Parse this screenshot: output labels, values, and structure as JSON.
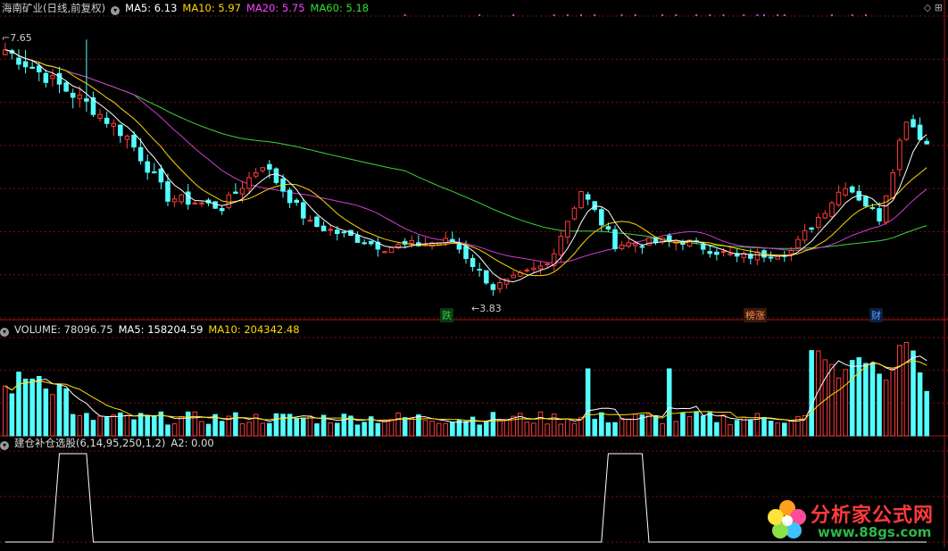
{
  "price_panel": {
    "title": "海南矿业(日线,前复权)",
    "ma": [
      {
        "label": "MA5: 6.13",
        "color": "#ffffff"
      },
      {
        "label": "MA10: 5.97",
        "color": "#ffd800"
      },
      {
        "label": "MA20: 5.75",
        "color": "#ff44ff"
      },
      {
        "label": "MA60: 5.18",
        "color": "#33dd33"
      }
    ],
    "high_label": "7.65",
    "low_label": "3.83",
    "event_tags": [
      {
        "text": "跌",
        "color": "#2ecc40"
      },
      {
        "text": "榜涨",
        "color": "#ff8c55"
      },
      {
        "text": "财",
        "color": "#5aa0ff"
      }
    ]
  },
  "volume_panel": {
    "title": "VOLUME: 78096.75",
    "ma5": "MA5: 158204.59",
    "ma10": "MA10: 204342.48"
  },
  "indicator_panel": {
    "title": "建仓补仓选股(6,14,95,250,1,2)",
    "a2": "A2: 0.00"
  },
  "watermark": {
    "cn": "分析家公式网",
    "url": "www.88gs.com"
  },
  "colors": {
    "up": "#ff3c3c",
    "down": "#54ffff",
    "ma5": "#ffffff",
    "ma10": "#ffd800",
    "ma20": "#d43cd4",
    "ma60": "#3ed23e",
    "grid": "#7a1010"
  },
  "chart_data": [
    {
      "type": "candlestick",
      "title": "海南矿业(日线,前复权)",
      "bars": 137,
      "ylim": [
        3.5,
        8.0
      ],
      "annotations": [
        {
          "label": "7.65",
          "kind": "high"
        },
        {
          "label": "3.83",
          "kind": "low"
        }
      ],
      "key_points": [
        {
          "bar": 0,
          "close": 7.5
        },
        {
          "bar": 12,
          "close": 6.7
        },
        {
          "bar": 18,
          "close": 6.2
        },
        {
          "bar": 24,
          "close": 5.3
        },
        {
          "bar": 32,
          "close": 5.15
        },
        {
          "bar": 38,
          "close": 5.8
        },
        {
          "bar": 45,
          "close": 4.9
        },
        {
          "bar": 56,
          "close": 4.55
        },
        {
          "bar": 66,
          "close": 4.65
        },
        {
          "bar": 72,
          "close": 3.95
        },
        {
          "bar": 80,
          "close": 4.3
        },
        {
          "bar": 85,
          "close": 5.4
        },
        {
          "bar": 90,
          "close": 4.6
        },
        {
          "bar": 100,
          "close": 4.65
        },
        {
          "bar": 108,
          "close": 4.4
        },
        {
          "bar": 116,
          "close": 4.5
        },
        {
          "bar": 124,
          "close": 5.5
        },
        {
          "bar": 129,
          "close": 5.0
        },
        {
          "bar": 133,
          "close": 6.5
        },
        {
          "bar": 136,
          "close": 6.1
        }
      ]
    },
    {
      "type": "bar",
      "title": "VOLUME: 78096.75",
      "series": [
        {
          "name": "MA5",
          "last": 158204.59
        },
        {
          "name": "MA10",
          "last": 204342.48
        }
      ],
      "last_value": 78096.75
    },
    {
      "type": "line",
      "title": "建仓补仓选股(6,14,95,250,1,2)",
      "series": [
        {
          "name": "A2",
          "last": 0.0
        }
      ],
      "signals": [
        {
          "from_bar": 8,
          "to_bar": 12,
          "value": 1
        },
        {
          "from_bar": 89,
          "to_bar": 94,
          "value": 1
        }
      ]
    }
  ]
}
